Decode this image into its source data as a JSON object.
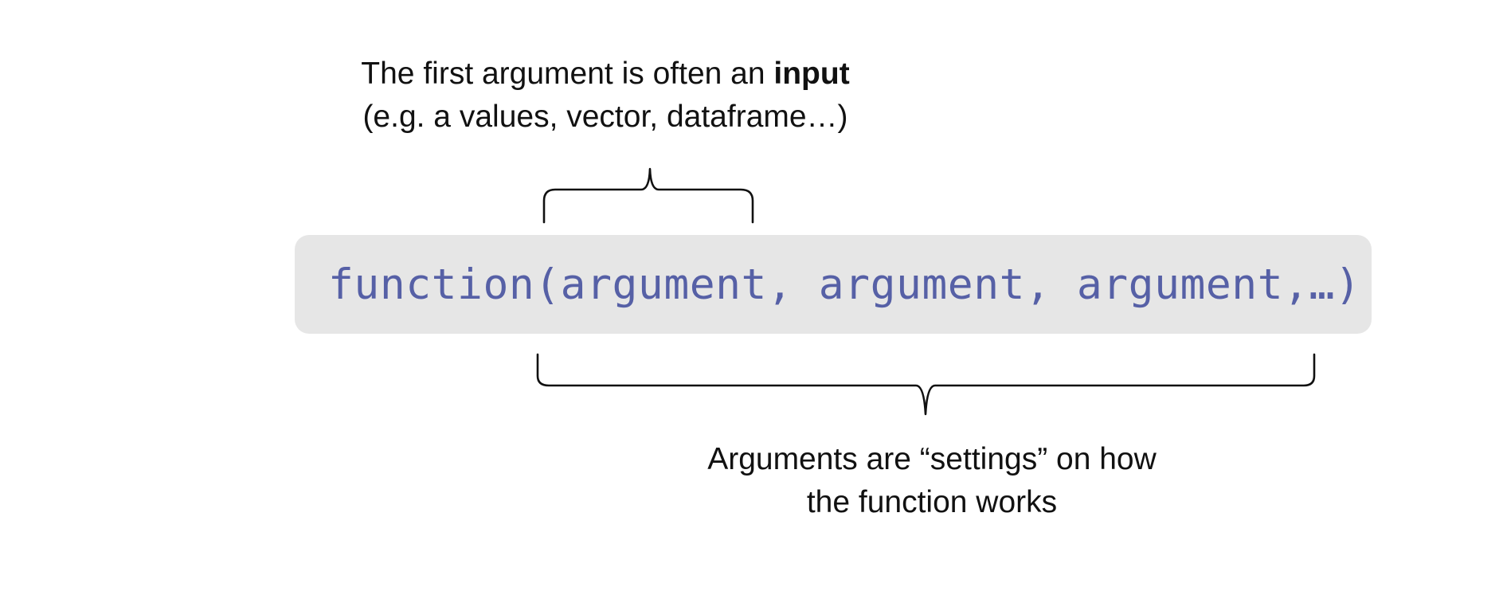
{
  "top_annotation": {
    "line1_prefix": "The first argument is often an ",
    "line1_bold": "input",
    "line2": "(e.g. a values, vector, dataframe…)"
  },
  "code": {
    "text": "function(argument, argument, argument,…)"
  },
  "bottom_annotation": {
    "line1": "Arguments are “settings” on how",
    "line2": "the function works"
  },
  "colors": {
    "code_text": "#5660a6",
    "code_background": "#e6e6e6",
    "bracket": "#111111"
  }
}
